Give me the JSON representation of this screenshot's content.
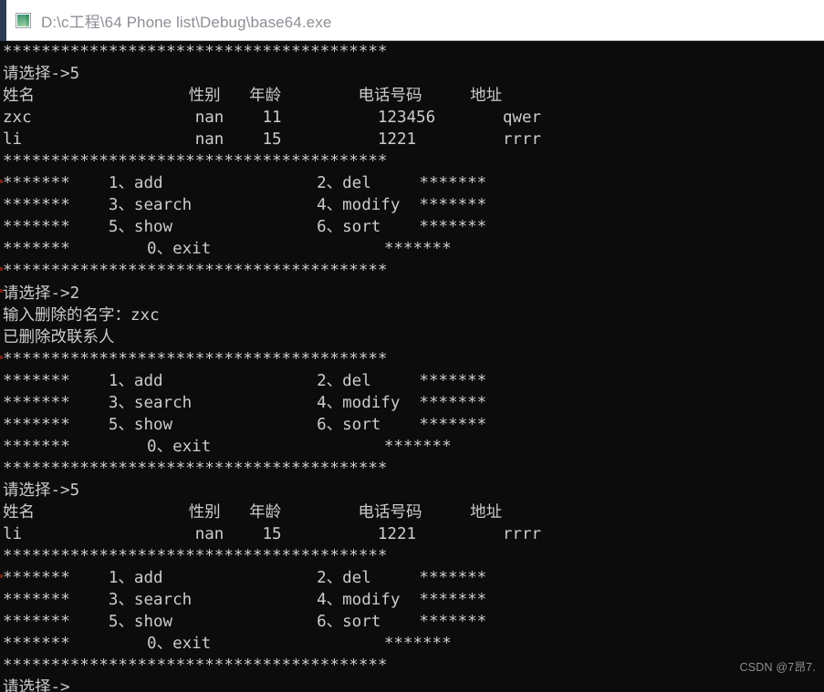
{
  "window": {
    "title": "D:\\c工程\\64 Phone list\\Debug\\base64.exe",
    "icon": "console-app-icon",
    "titlebar_bg": "#ffffff",
    "titlebar_text_color": "#8c8f96",
    "accent_color": "#2b3a55"
  },
  "console": {
    "background": "#0c0c0c",
    "foreground": "#cccccc",
    "separator_long": "****************************************",
    "separator_short": "*******",
    "prompt_label": "请选择->",
    "menu": {
      "items": [
        {
          "number": "1",
          "sep": "、",
          "label": "add"
        },
        {
          "number": "2",
          "sep": "、",
          "label": "del"
        },
        {
          "number": "3",
          "sep": "、",
          "label": "search"
        },
        {
          "number": "4",
          "sep": "、",
          "label": "modify"
        },
        {
          "number": "5",
          "sep": "、",
          "label": "show"
        },
        {
          "number": "6",
          "sep": "、",
          "label": "sort"
        },
        {
          "number": "0",
          "sep": "、",
          "label": "exit"
        }
      ]
    },
    "table": {
      "headers": [
        "姓名",
        "性别",
        "年龄",
        "电话号码",
        "地址"
      ]
    },
    "contacts_before_delete": [
      {
        "name": "zxc",
        "gender": "nan",
        "age": "11",
        "phone": "123456",
        "address": "qwer"
      },
      {
        "name": "li",
        "gender": "nan",
        "age": "15",
        "phone": "1221",
        "address": "rrrr"
      }
    ],
    "contacts_after_delete": [
      {
        "name": "li",
        "gender": "nan",
        "age": "15",
        "phone": "1221",
        "address": "rrrr"
      }
    ],
    "delete_session": {
      "choice_line": "请选择->2",
      "input_prompt": "输入删除的名字：zxc",
      "result_message": "已删除改联系人"
    },
    "show_choice_line": "请选择->5",
    "final_prompt": "请选择->",
    "transcript": [
      "****************************************",
      "请选择->5",
      "姓名                性别    年龄        电话号码        地址",
      "zxc                 nan     11          123456          qwer",
      "li                  nan     15          1221            rrrr",
      "****************************************",
      "*******    1、add      2、del   *******",
      "*******    3、search   4、modify *******",
      "*******    5、show     6、sort   *******",
      "*******        0、exit           *******",
      "****************************************",
      "请选择->2",
      "输入删除的名字：zxc",
      "已删除改联系人",
      "****************************************",
      "*******    1、add      2、del   *******",
      "*******    3、search   4、modify *******",
      "*******    5、show     6、sort   *******",
      "*******        0、exit           *******",
      "****************************************",
      "请选择->5",
      "姓名                性别    年龄        电话号码        地址",
      "li                  nan     15          1221            rrrr",
      "****************************************",
      "*******    1、add      2、del   *******",
      "*******    3、search   4、modify *******",
      "*******    5、show     6、sort   *******",
      "*******        0、exit           *******",
      "****************************************",
      "请选择->"
    ]
  },
  "watermark": {
    "text": "CSDN @7昂7."
  }
}
